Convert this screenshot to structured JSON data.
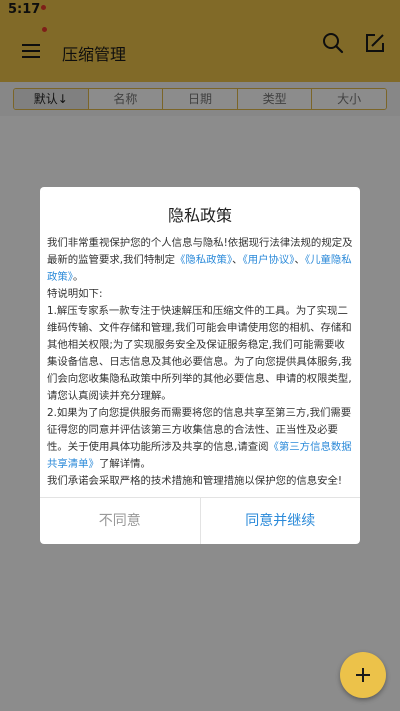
{
  "status_bar": {
    "time": "5:17"
  },
  "app_bar": {
    "title": "压缩管理"
  },
  "sort_tabs": [
    {
      "label": "默认↓",
      "active": true
    },
    {
      "label": "名称",
      "active": false
    },
    {
      "label": "日期",
      "active": false
    },
    {
      "label": "类型",
      "active": false
    },
    {
      "label": "大小",
      "active": false
    }
  ],
  "dialog": {
    "title": "隐私政策",
    "p1_pre": "我们非常重视保护您的个人信息与隐私!依据现行法律法规的规定及最新的监管要求,我们特制定",
    "link_privacy": "《隐私政策》",
    "sep1": "、",
    "link_user": "《用户协议》",
    "sep2": "、",
    "link_children": "《儿童隐私政策》",
    "p1_end": "。",
    "p2": "特说明如下:",
    "p3": "1.解压专家系一款专注于快速解压和压缩文件的工具。为了实现二维码传输、文件存储和管理,我们可能会申请使用您的相机、存储和其他相关权限;为了实现服务安全及保证服务稳定,我们可能需要收集设备信息、日志信息及其他必要信息。为了向您提供具体服务,我们会向您收集隐私政策中所列举的其他必要信息、申请的权限类型,请您认真阅读并充分理解。",
    "p4_pre": "2.如果为了向您提供服务而需要将您的信息共享至第三方,我们需要征得您的同意并评估该第三方收集信息的合法性、正当性及必要性。关于使用具体功能所涉及共享的信息,请查阅",
    "link_third": "《第三方信息数据共享清单》",
    "p4_end": "了解详情。",
    "p5": "我们承诺会采取严格的技术措施和管理措施以保护您的信息安全!",
    "btn_disagree": "不同意",
    "btn_agree": "同意并继续"
  },
  "colors": {
    "accent": "#ecc24a",
    "link": "#2b8ad9",
    "notification_dot": "#e5392d"
  },
  "icons": {
    "menu": "menu-icon",
    "search": "search-icon",
    "edit": "edit-icon",
    "fab": "plus-icon"
  }
}
